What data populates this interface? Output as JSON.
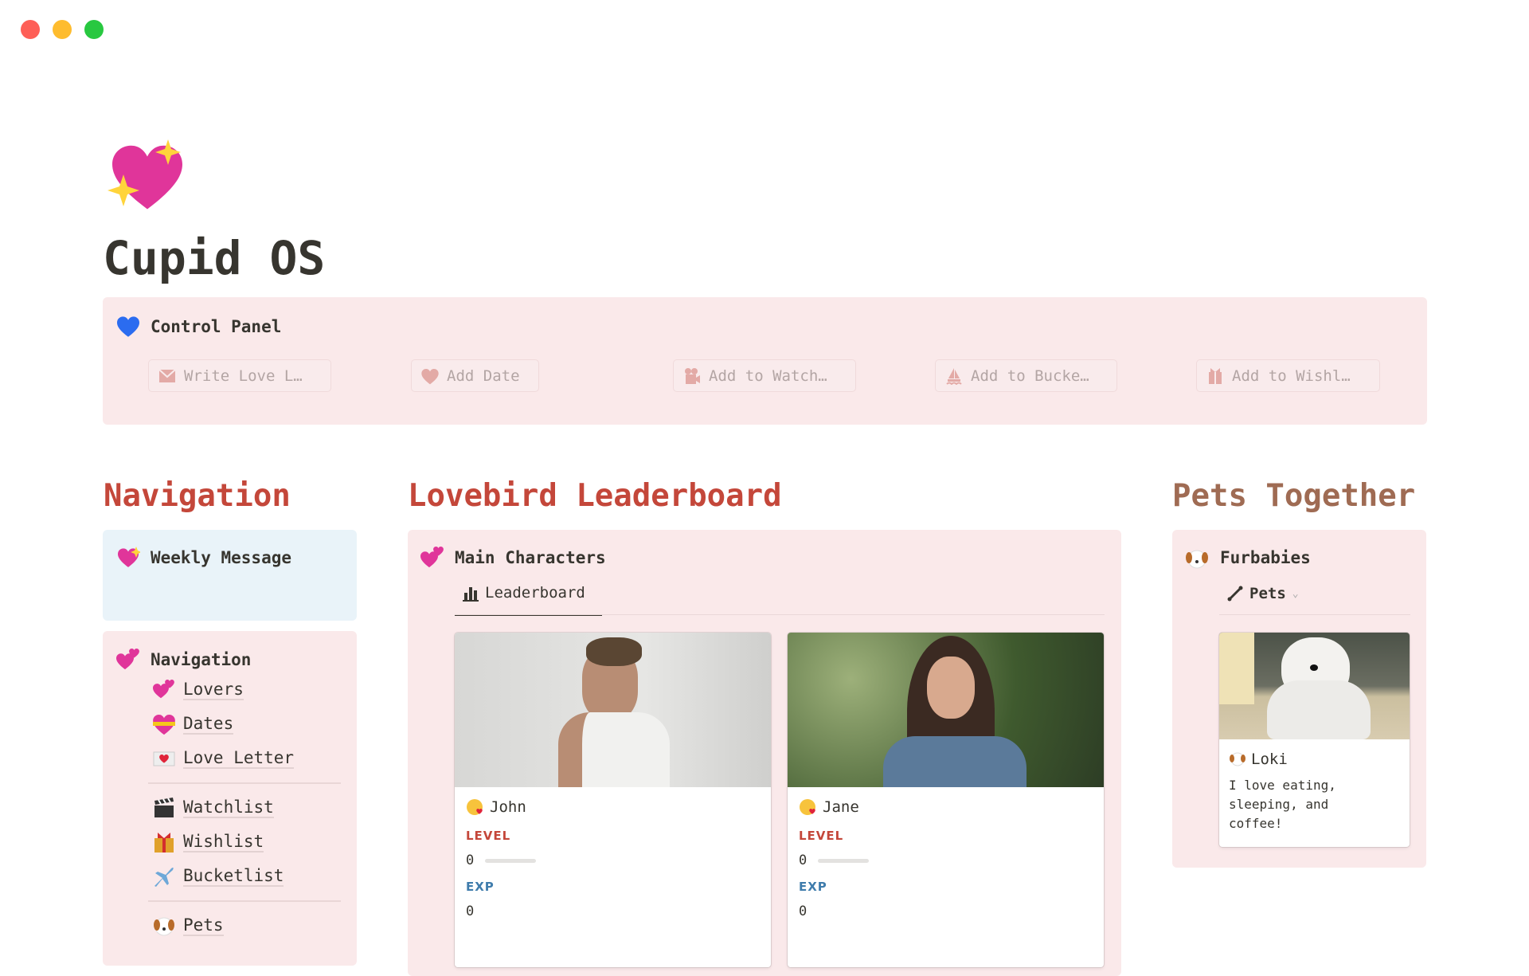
{
  "window": {
    "controls": [
      "close",
      "minimize",
      "maximize"
    ],
    "colors": {
      "close": "#fe5f57",
      "minimize": "#febc2e",
      "maximize": "#28c840"
    }
  },
  "page": {
    "icon": "sparkling-heart-icon",
    "title": "Cupid OS"
  },
  "control_panel": {
    "icon": "blue-heart-icon",
    "title": "Control Panel",
    "buttons": [
      {
        "label": "Write Love L…",
        "icon": "envelope-icon"
      },
      {
        "label": "Add Date",
        "icon": "heart-icon"
      },
      {
        "label": "Add to Watch…",
        "icon": "movie-camera-icon"
      },
      {
        "label": "Add to Bucke…",
        "icon": "sailboat-icon"
      },
      {
        "label": "Add to Wishl…",
        "icon": "gift-icon"
      }
    ]
  },
  "sections": {
    "navigation": "Navigation",
    "leaderboard": "Lovebird Leaderboard",
    "pets": "Pets Together"
  },
  "weekly_message": {
    "icon": "sparkling-heart-icon",
    "title": "Weekly Message"
  },
  "navigation": {
    "icon": "revolving-hearts-icon",
    "title": "Navigation",
    "items": [
      {
        "label": "Lovers",
        "icon": "revolving-hearts-icon"
      },
      {
        "label": "Dates",
        "icon": "heart-with-ribbon-icon"
      },
      {
        "label": "Love Letter",
        "icon": "love-letter-icon"
      },
      {
        "label": "Watchlist",
        "icon": "clapper-board-icon"
      },
      {
        "label": "Wishlist",
        "icon": "gift-icon"
      },
      {
        "label": "Bucketlist",
        "icon": "airplane-icon"
      },
      {
        "label": "Pets",
        "icon": "dog-face-icon"
      }
    ]
  },
  "main_characters": {
    "icon": "revolving-hearts-icon",
    "title": "Main Characters",
    "tab": "Leaderboard",
    "cards": [
      {
        "name": "John",
        "level_label": "LEVEL",
        "level": "0",
        "level_progress": 0,
        "exp_label": "EXP",
        "exp": "0"
      },
      {
        "name": "Jane",
        "level_label": "LEVEL",
        "level": "0",
        "level_progress": 0,
        "exp_label": "EXP",
        "exp": "0"
      }
    ]
  },
  "furbabies": {
    "icon": "dog-face-icon",
    "title": "Furbabies",
    "view": "Pets",
    "cards": [
      {
        "name": "Loki",
        "description": "I love eating, sleeping, and coffee!"
      }
    ]
  },
  "colors": {
    "accent": "#c4473a",
    "pets_heading": "#9f6b53",
    "panel": "#fae9ea",
    "weekly": "#e9f3f9",
    "exp": "#3f7cac"
  }
}
